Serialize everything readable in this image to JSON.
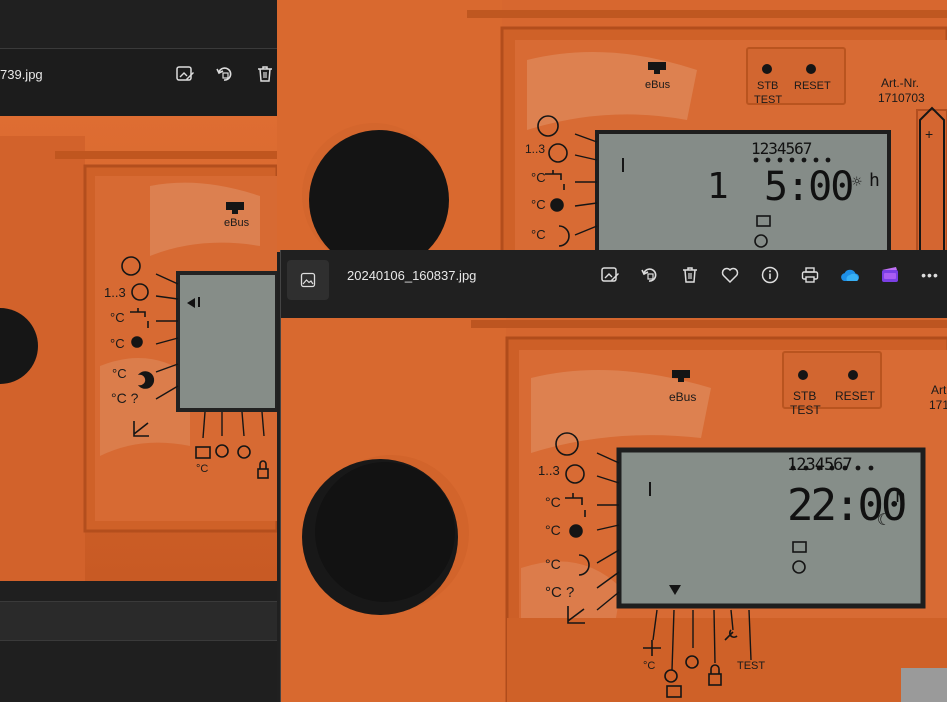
{
  "left_window": {
    "filename": "739.jpg",
    "toolbar_icons": [
      "edit-image-icon",
      "rotate-icon",
      "delete-icon"
    ],
    "panel": {
      "ebus": "eBus",
      "left_labels": [
        "1..3",
        "°C",
        "°C",
        "°C",
        "°C ?"
      ],
      "bottom_labels": [
        "°C"
      ]
    }
  },
  "back_window": {
    "panel": {
      "ebus": "eBus",
      "stb": "STB",
      "test": "TEST",
      "reset": "RESET",
      "artnr_label": "Art.-Nr.",
      "artnr": "1710703",
      "plus": "+",
      "lcd_days": "1234567",
      "lcd_day": "1",
      "lcd_time": "5:00",
      "lcd_unit": "h",
      "left_labels": [
        "1..3",
        "°C",
        "°C",
        "°C"
      ]
    }
  },
  "front_window": {
    "filename": "20240106_160837.jpg",
    "toolbar_icons": [
      "edit-image-icon",
      "rotate-icon",
      "delete-icon",
      "favorite-icon",
      "info-icon",
      "print-icon",
      "onedrive-icon",
      "clipchamp-icon",
      "more-icon"
    ],
    "more_label": "•••",
    "panel": {
      "ebus": "eBus",
      "stb": "STB",
      "test": "TEST",
      "reset": "RESET",
      "artnr_label": "Art",
      "artnr": "171",
      "lcd_days": "1234567",
      "lcd_time": "22:00",
      "lcd_unit": "h",
      "left_labels": [
        "1..3",
        "°C",
        "°C",
        "°C",
        "°C ?"
      ],
      "bottom_celsius": "°C",
      "bottom_test": "TEST"
    }
  },
  "colors": {
    "housing": "#d9662c",
    "housing_dark": "#b85020",
    "lcd": "#8a918c",
    "knob": "#151515",
    "toolbar": "#202020"
  }
}
